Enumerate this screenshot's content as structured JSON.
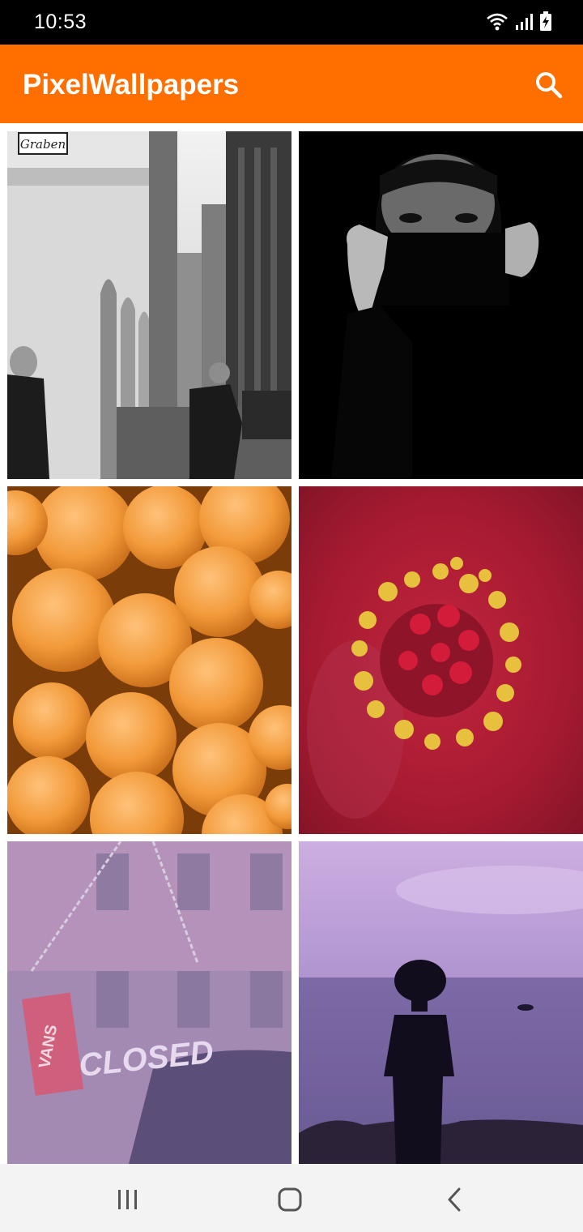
{
  "status_bar": {
    "time": "10:53",
    "icons": [
      "wifi-icon",
      "signal-icon",
      "battery-charging-icon"
    ]
  },
  "app_bar": {
    "title": "PixelWallpapers",
    "search_icon": "search-icon",
    "color": "#ff6f00"
  },
  "wallpapers": [
    {
      "subject": "street-photo",
      "sign_text": "Graben"
    },
    {
      "subject": "portrait-photo"
    },
    {
      "subject": "oranges-photo"
    },
    {
      "subject": "flower-photo"
    },
    {
      "subject": "shop-sign-photo",
      "sign_text": "CLOSED",
      "logo_text": "VANS"
    },
    {
      "subject": "sea-silhouette-photo"
    }
  ],
  "nav_bar": {
    "icons": [
      "recents-icon",
      "home-icon",
      "back-icon"
    ]
  }
}
